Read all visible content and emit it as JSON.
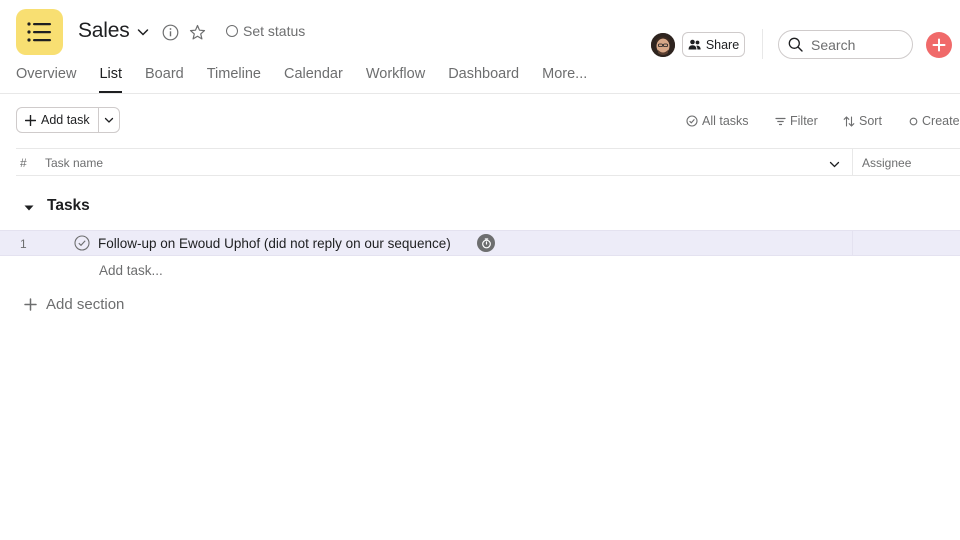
{
  "project": {
    "title": "Sales",
    "set_status_label": "Set status"
  },
  "tabs": [
    {
      "label": "Overview",
      "active": false
    },
    {
      "label": "List",
      "active": true
    },
    {
      "label": "Board",
      "active": false
    },
    {
      "label": "Timeline",
      "active": false
    },
    {
      "label": "Calendar",
      "active": false
    },
    {
      "label": "Workflow",
      "active": false
    },
    {
      "label": "Dashboard",
      "active": false
    },
    {
      "label": "More...",
      "active": false
    }
  ],
  "header_actions": {
    "share_label": "Share",
    "search_placeholder": "Search"
  },
  "toolbar": {
    "add_task_label": "Add task",
    "all_tasks_label": "All tasks",
    "filter_label": "Filter",
    "sort_label": "Sort",
    "create_label": "Create"
  },
  "table": {
    "columns": {
      "number": "#",
      "task_name": "Task name",
      "assignee": "Assignee"
    },
    "sections": [
      {
        "title": "Tasks",
        "tasks": [
          {
            "number": "1",
            "name": "Follow-up on Ewoud Uphof (did not reply on our sequence)"
          }
        ],
        "add_task_label": "Add task..."
      }
    ],
    "add_section_label": "Add section"
  },
  "colors": {
    "accent_yellow": "#f8df72",
    "add_button_red": "#f06a6a",
    "selected_row": "#edecf8",
    "text_primary": "#1e1f21",
    "text_secondary": "#6d6e6f"
  },
  "icons": [
    "list-icon",
    "chevron-down-icon",
    "info-icon",
    "star-icon",
    "status-circle-icon",
    "people-icon",
    "search-icon",
    "plus-icon",
    "check-circle-icon",
    "filter-icon",
    "sort-icon",
    "caret-down-icon",
    "complete-check-icon",
    "timer-icon"
  ]
}
